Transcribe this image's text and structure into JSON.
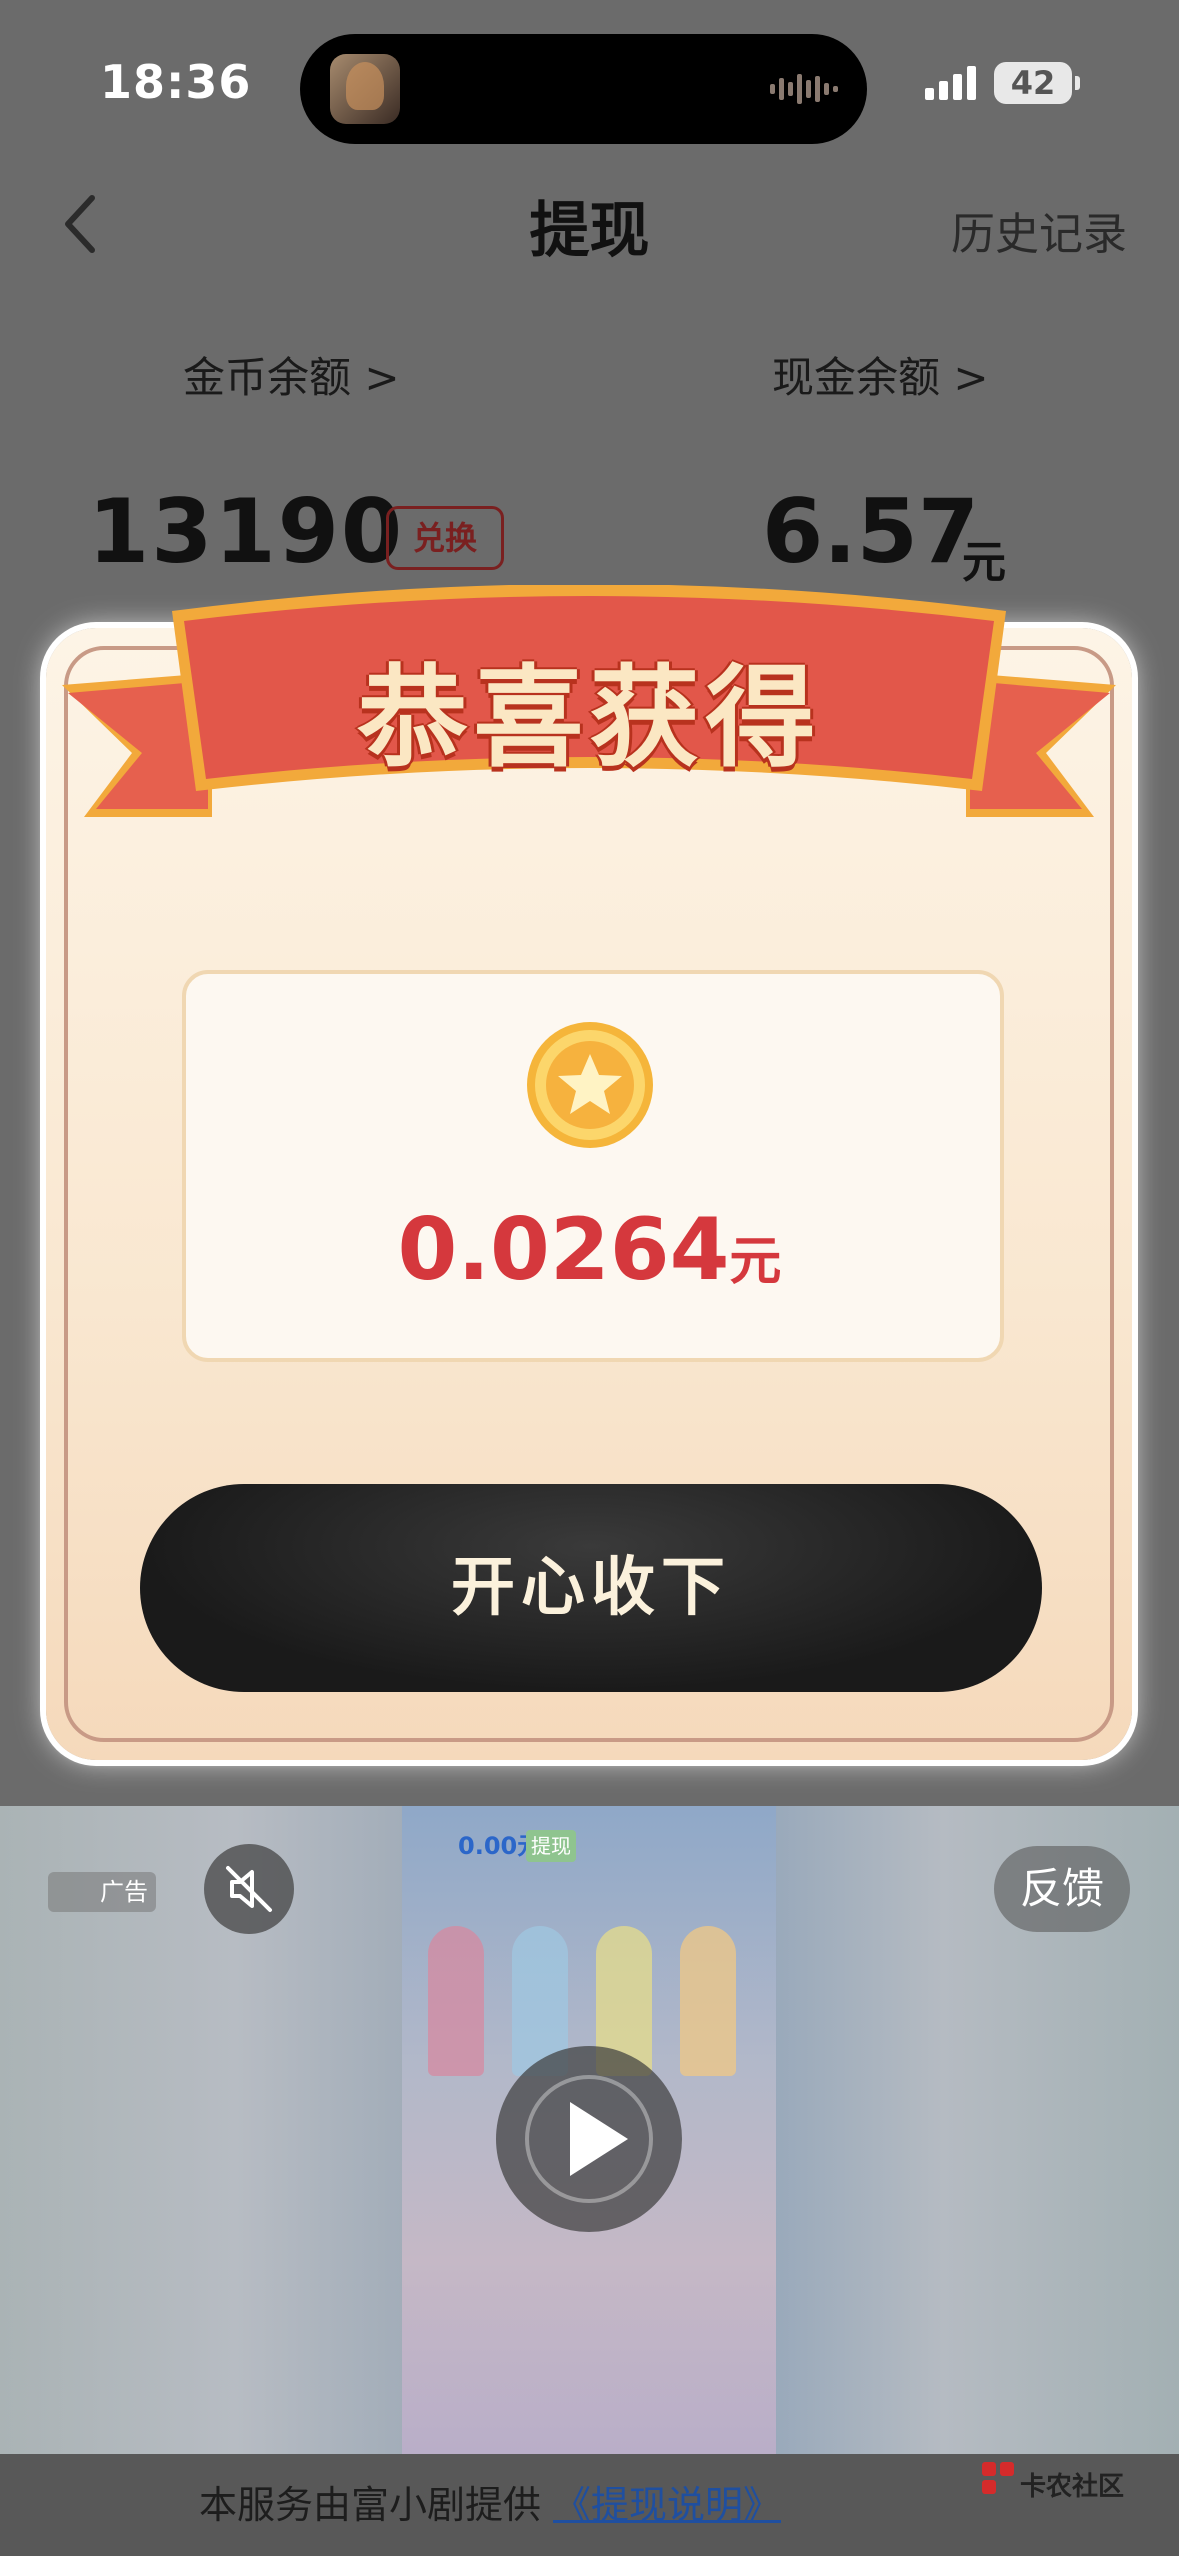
{
  "status_bar": {
    "time": "18:36",
    "battery": "42"
  },
  "header": {
    "title": "提现",
    "history": "历史记录"
  },
  "balances": {
    "coin_label": "金币余额 >",
    "cash_label": "现金余额 >",
    "coins": "13190",
    "exchange": "兑换",
    "cash": "6.57",
    "cash_unit": "元"
  },
  "modal": {
    "title": "恭喜获得",
    "amount": "0.0264",
    "amount_unit": "元",
    "accept": "开心收下"
  },
  "ad": {
    "badge": "广告",
    "feedback": "反馈",
    "video_balance": "0.00元",
    "video_tag": "提现"
  },
  "footer": {
    "text": "本服务由富小剧提供",
    "link": "《提现说明》",
    "watermark": "卡农社区"
  },
  "colors": {
    "reward_red": "#d5383d",
    "ribbon_red": "#e2574a",
    "ribbon_gold": "#f2a93b"
  }
}
